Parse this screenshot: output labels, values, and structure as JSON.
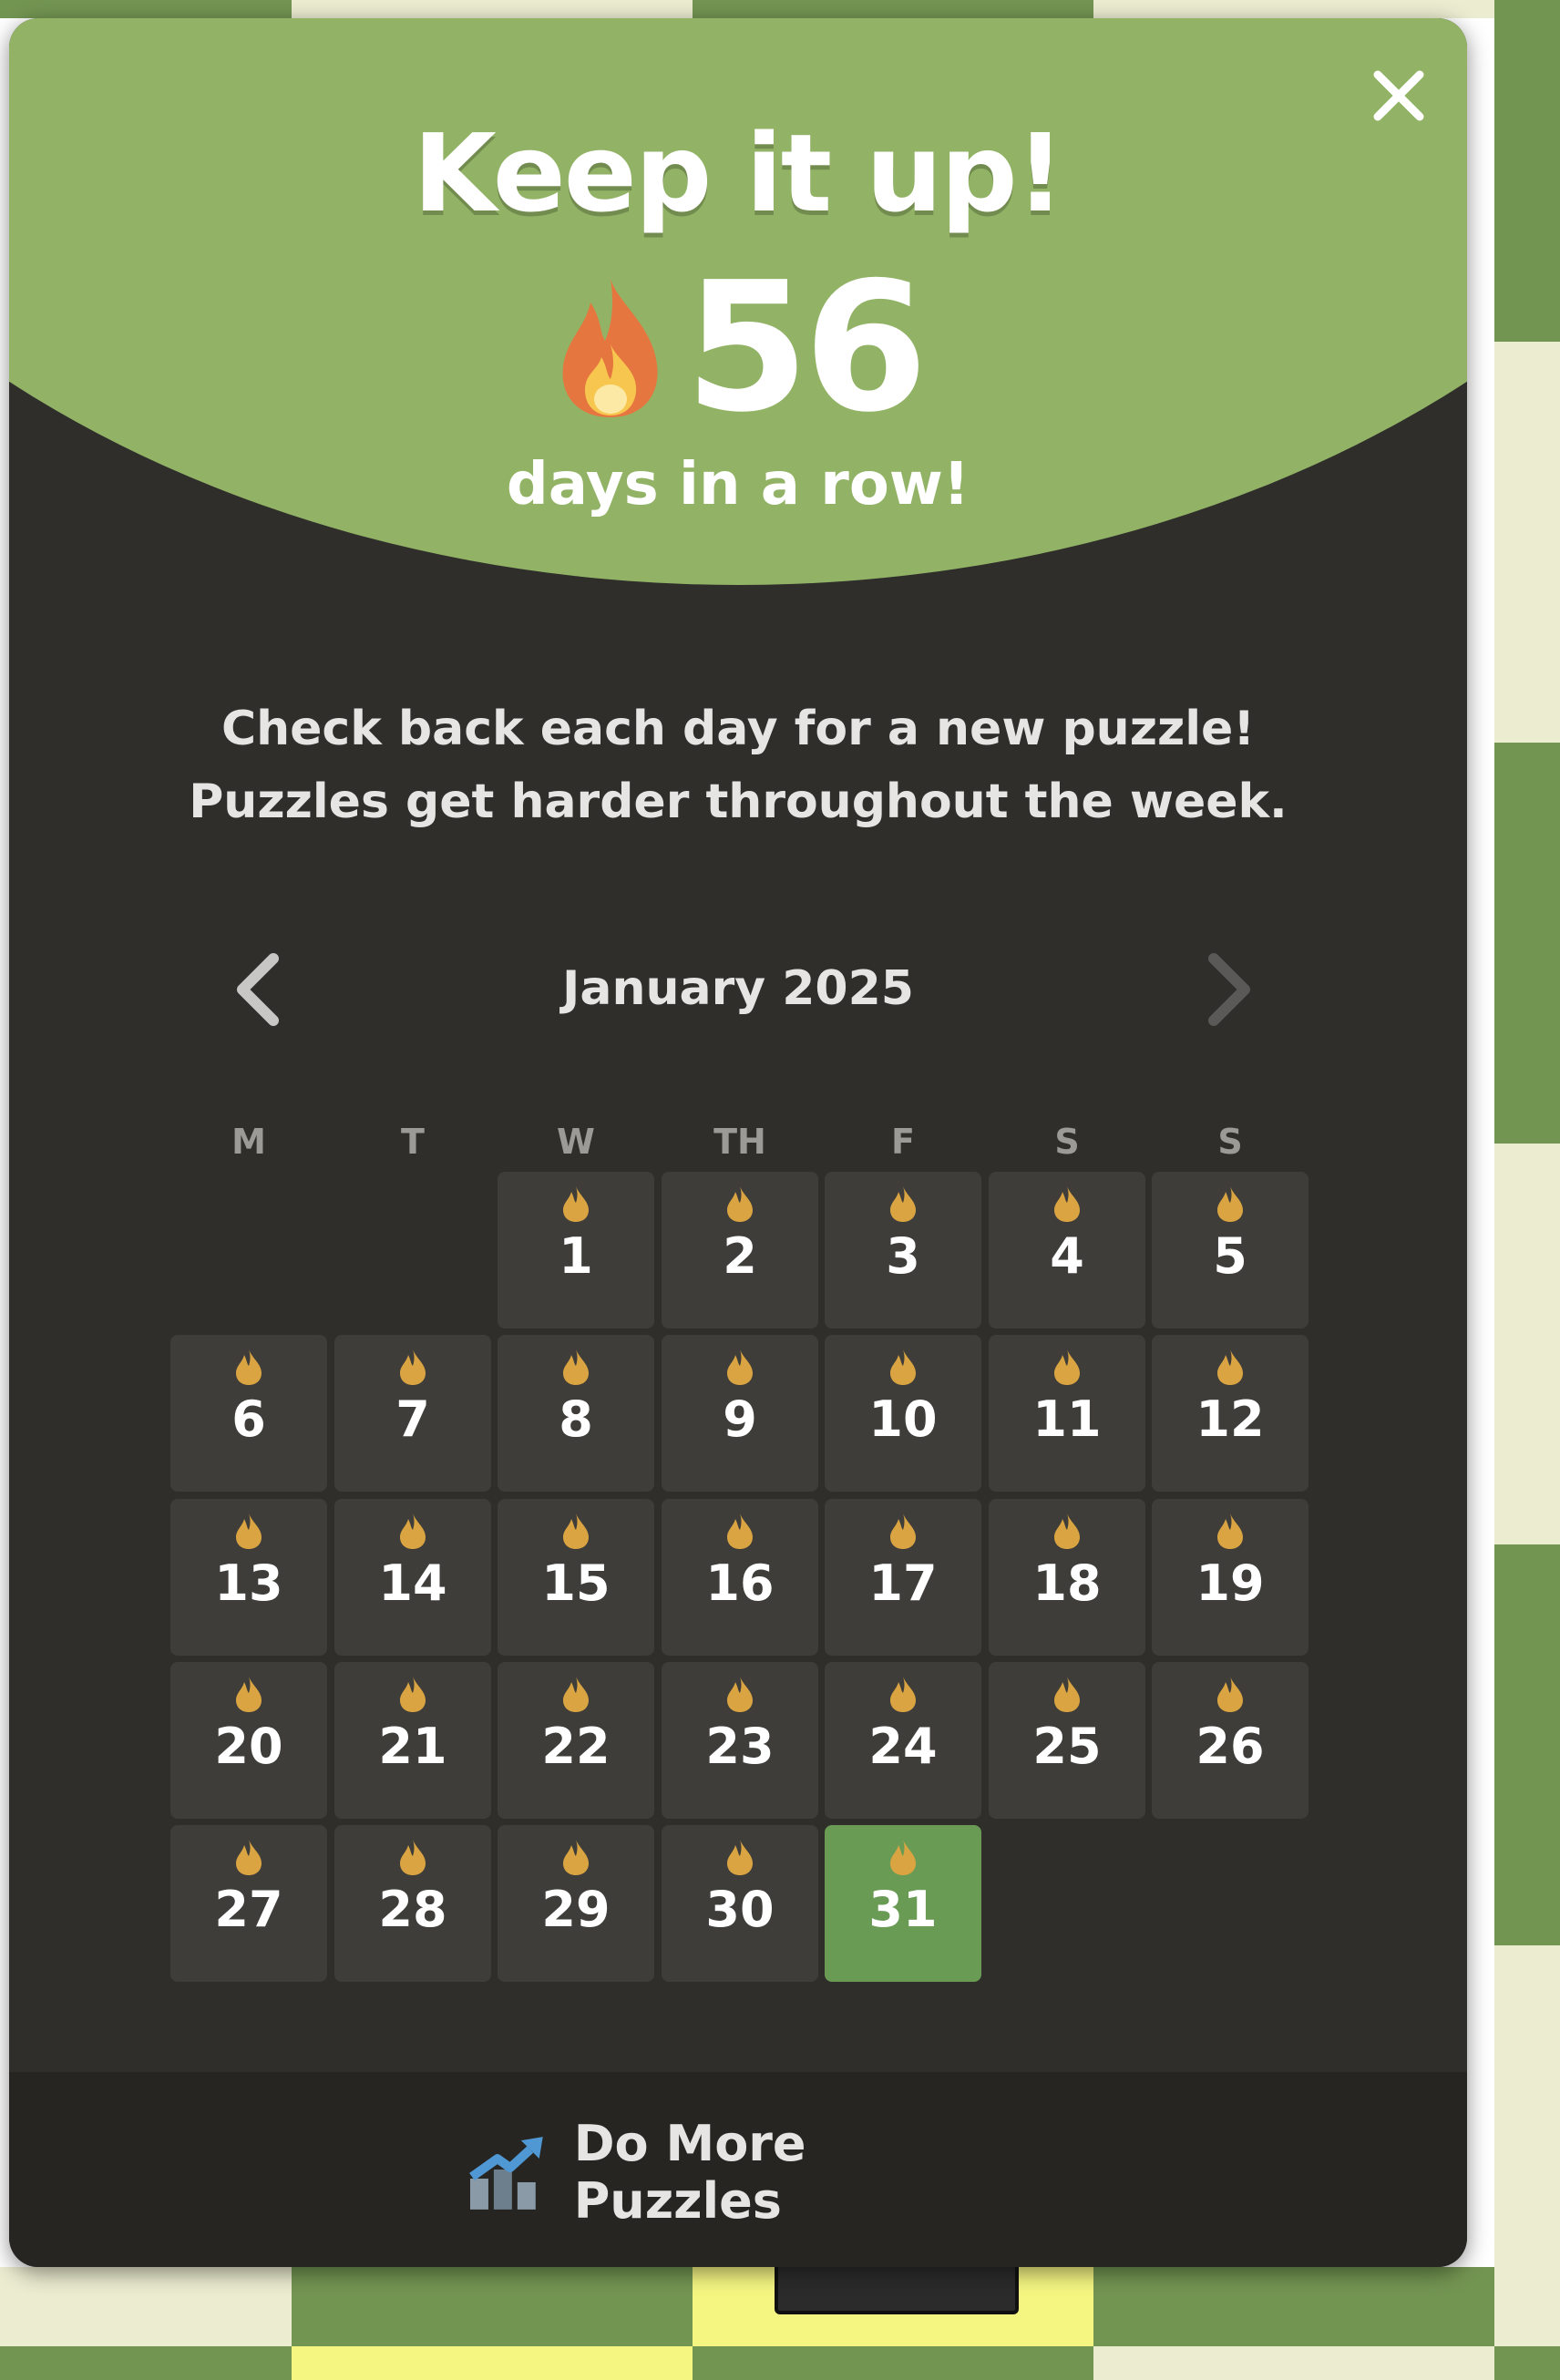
{
  "header": {
    "title": "Keep it up!",
    "streak_count": "56",
    "streak_label": "days in a row!"
  },
  "message": {
    "line1": "Check back each day for a new puzzle!",
    "line2": "Puzzles get harder throughout the week."
  },
  "calendar": {
    "month": "January 2025",
    "weekdays": [
      "M",
      "T",
      "W",
      "TH",
      "F",
      "S",
      "S"
    ],
    "days": [
      "1",
      "2",
      "3",
      "4",
      "5",
      "6",
      "7",
      "8",
      "9",
      "10",
      "11",
      "12",
      "13",
      "14",
      "15",
      "16",
      "17",
      "18",
      "19",
      "20",
      "21",
      "22",
      "23",
      "24",
      "25",
      "26",
      "27",
      "28",
      "29",
      "30",
      "31"
    ],
    "today": "31"
  },
  "footer": {
    "button_label": "Do More Puzzles"
  },
  "icons": {
    "close": "close-icon",
    "flame": "flame-icon",
    "prev": "chevron-left-icon",
    "next": "chevron-right-icon",
    "puzzles": "trending-chart-icon"
  },
  "colors": {
    "header_green": "#92b366",
    "modal_bg": "#2f2e2b",
    "day_cell": "#3e3d3a",
    "today_cell": "#6a9b55",
    "footer_bg": "#262522",
    "flame_small": "#d9a441"
  }
}
